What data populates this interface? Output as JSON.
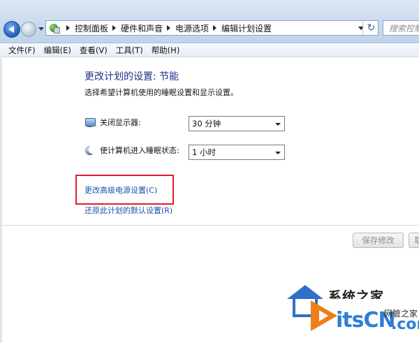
{
  "address_bar": {
    "breadcrumbs": [
      "控制面板",
      "硬件和声音",
      "电源选项",
      "编辑计划设置"
    ],
    "search_placeholder": "搜索控制",
    "refresh_symbol": "↻"
  },
  "menu": {
    "items": [
      "文件(F)",
      "编辑(E)",
      "查看(V)",
      "工具(T)",
      "帮助(H)"
    ]
  },
  "content": {
    "heading": "更改计划的设置: 节能",
    "description": "选择希望计算机使用的睡眠设置和显示设置。",
    "display_off": {
      "label": "关闭显示器:",
      "value": "30 分钟"
    },
    "sleep": {
      "label": "使计算机进入睡眠状态:",
      "value": "1 小时"
    },
    "advanced_link": "更改高级电源设置(C)",
    "restore_link": "还原此计划的默认设置(R)"
  },
  "buttons": {
    "save": "保存修改",
    "cancel": "取消"
  },
  "watermark": {
    "title": "系统之家",
    "brand": "itsCN",
    "sub": "网管之家",
    "domain": ".com"
  },
  "colors": {
    "heading": "#1e3287",
    "link": "#1554b0",
    "highlight_box": "#e21c25"
  }
}
